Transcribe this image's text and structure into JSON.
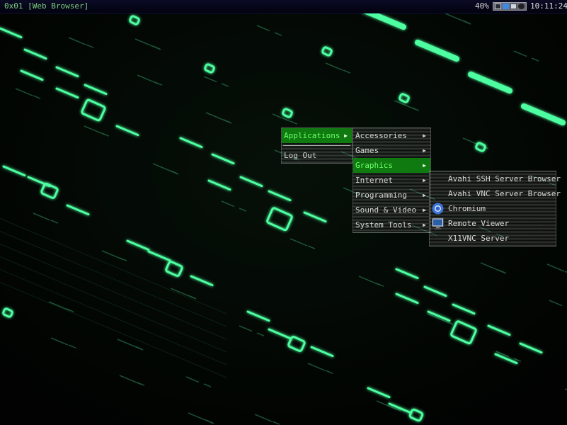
{
  "panel": {
    "window_label": "0x01 [Web Browser]",
    "battery": "40%",
    "clock": "10:11:24",
    "tray_icons": [
      "terminal-icon",
      "folder-icon",
      "display-icon",
      "power-icon"
    ]
  },
  "root_menu": {
    "items": [
      {
        "label": "Applications",
        "has_submenu": true,
        "active": true
      },
      {
        "label": "Log Out",
        "has_submenu": false,
        "active": false
      }
    ]
  },
  "applications_menu": {
    "items": [
      {
        "label": "Accessories",
        "has_submenu": true
      },
      {
        "label": "Games",
        "has_submenu": true
      },
      {
        "label": "Graphics",
        "has_submenu": true,
        "active": true
      },
      {
        "label": "Internet",
        "has_submenu": true
      },
      {
        "label": "Programming",
        "has_submenu": true
      },
      {
        "label": "Sound & Video",
        "has_submenu": true
      },
      {
        "label": "System Tools",
        "has_submenu": true
      }
    ]
  },
  "graphics_menu": {
    "items": [
      {
        "label": "Avahi SSH Server Browser",
        "icon": ""
      },
      {
        "label": "Avahi VNC Server Browser",
        "icon": ""
      },
      {
        "label": "Chromium",
        "icon": "chromium-icon"
      },
      {
        "label": "Remote Viewer",
        "icon": "monitor-icon"
      },
      {
        "label": "X11VNC Server",
        "icon": ""
      }
    ]
  },
  "colors": {
    "accent_green": "#0f7a0f",
    "neon": "#4dff9a",
    "background": "#020403"
  }
}
